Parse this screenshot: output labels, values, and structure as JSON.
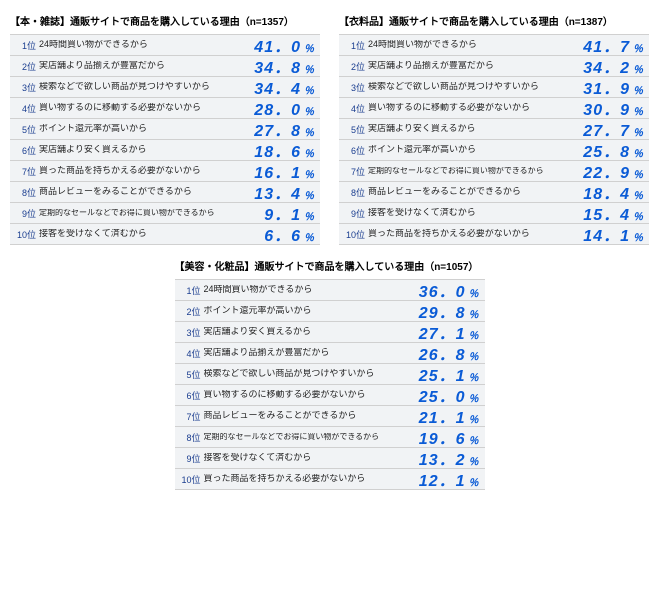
{
  "pct_label": "％",
  "rank_suffix": "位",
  "charts": [
    {
      "title": "【本・雑誌】通販サイトで商品を購入している理由（n=1357）",
      "rows": [
        {
          "rank": 1,
          "label": "24時間買い物ができるから",
          "value": "41．0"
        },
        {
          "rank": 2,
          "label": "実店舗より品揃えが豊富だから",
          "value": "34．8"
        },
        {
          "rank": 3,
          "label": "検索などで欲しい商品が見つけやすいから",
          "value": "34．4"
        },
        {
          "rank": 4,
          "label": "買い物するのに移動する必要がないから",
          "value": "28．0"
        },
        {
          "rank": 5,
          "label": "ポイント還元率が高いから",
          "value": "27．8"
        },
        {
          "rank": 6,
          "label": "実店舗より安く買えるから",
          "value": "18．6"
        },
        {
          "rank": 7,
          "label": "買った商品を持ちかえる必要がないから",
          "value": "16．1"
        },
        {
          "rank": 8,
          "label": "商品レビューをみることができるから",
          "value": "13．4"
        },
        {
          "rank": 9,
          "label": "定期的なセールなどでお得に買い物ができるから",
          "value": "9．1",
          "small": true
        },
        {
          "rank": 10,
          "label": "接客を受けなくて済むから",
          "value": "6．6"
        }
      ]
    },
    {
      "title": "【衣料品】通販サイトで商品を購入している理由（n=1387）",
      "rows": [
        {
          "rank": 1,
          "label": "24時間買い物ができるから",
          "value": "41．7"
        },
        {
          "rank": 2,
          "label": "実店舗より品揃えが豊富だから",
          "value": "34．2"
        },
        {
          "rank": 3,
          "label": "検索などで欲しい商品が見つけやすいから",
          "value": "31．9"
        },
        {
          "rank": 4,
          "label": "買い物するのに移動する必要がないから",
          "value": "30．9"
        },
        {
          "rank": 5,
          "label": "実店舗より安く買えるから",
          "value": "27．7"
        },
        {
          "rank": 6,
          "label": "ポイント還元率が高いから",
          "value": "25．8"
        },
        {
          "rank": 7,
          "label": "定期的なセールなどでお得に買い物ができるから",
          "value": "22．9",
          "small": true
        },
        {
          "rank": 8,
          "label": "商品レビューをみることができるから",
          "value": "18．4"
        },
        {
          "rank": 9,
          "label": "接客を受けなくて済むから",
          "value": "15．4"
        },
        {
          "rank": 10,
          "label": "買った商品を持ちかえる必要がないから",
          "value": "14．1"
        }
      ]
    },
    {
      "title": "【美容・化粧品】通販サイトで商品を購入している理由（n=1057）",
      "rows": [
        {
          "rank": 1,
          "label": "24時間買い物ができるから",
          "value": "36．0"
        },
        {
          "rank": 2,
          "label": "ポイント還元率が高いから",
          "value": "29．8"
        },
        {
          "rank": 3,
          "label": "実店舗より安く買えるから",
          "value": "27．1"
        },
        {
          "rank": 4,
          "label": "実店舗より品揃えが豊富だから",
          "value": "26．8"
        },
        {
          "rank": 5,
          "label": "検索などで欲しい商品が見つけやすいから",
          "value": "25．1"
        },
        {
          "rank": 6,
          "label": "買い物するのに移動する必要がないから",
          "value": "25．0"
        },
        {
          "rank": 7,
          "label": "商品レビューをみることができるから",
          "value": "21．1"
        },
        {
          "rank": 8,
          "label": "定期的なセールなどでお得に買い物ができるから",
          "value": "19．6",
          "small": true
        },
        {
          "rank": 9,
          "label": "接客を受けなくて済むから",
          "value": "13．2"
        },
        {
          "rank": 10,
          "label": "買った商品を持ちかえる必要がないから",
          "value": "12．1"
        }
      ]
    }
  ],
  "chart_data": [
    {
      "type": "table",
      "title": "【本・雑誌】通販サイトで商品を購入している理由",
      "n": 1357,
      "categories": [
        "24時間買い物ができるから",
        "実店舗より品揃えが豊富だから",
        "検索などで欲しい商品が見つけやすいから",
        "買い物するのに移動する必要がないから",
        "ポイント還元率が高いから",
        "実店舗より安く買えるから",
        "買った商品を持ちかえる必要がないから",
        "商品レビューをみることができるから",
        "定期的なセールなどでお得に買い物ができるから",
        "接客を受けなくて済むから"
      ],
      "values": [
        41.0,
        34.8,
        34.4,
        28.0,
        27.8,
        18.6,
        16.1,
        13.4,
        9.1,
        6.6
      ],
      "unit": "%"
    },
    {
      "type": "table",
      "title": "【衣料品】通販サイトで商品を購入している理由",
      "n": 1387,
      "categories": [
        "24時間買い物ができるから",
        "実店舗より品揃えが豊富だから",
        "検索などで欲しい商品が見つけやすいから",
        "買い物するのに移動する必要がないから",
        "実店舗より安く買えるから",
        "ポイント還元率が高いから",
        "定期的なセールなどでお得に買い物ができるから",
        "商品レビューをみることができるから",
        "接客を受けなくて済むから",
        "買った商品を持ちかえる必要がないから"
      ],
      "values": [
        41.7,
        34.2,
        31.9,
        30.9,
        27.7,
        25.8,
        22.9,
        18.4,
        15.4,
        14.1
      ],
      "unit": "%"
    },
    {
      "type": "table",
      "title": "【美容・化粧品】通販サイトで商品を購入している理由",
      "n": 1057,
      "categories": [
        "24時間買い物ができるから",
        "ポイント還元率が高いから",
        "実店舗より安く買えるから",
        "実店舗より品揃えが豊富だから",
        "検索などで欲しい商品が見つけやすいから",
        "買い物するのに移動する必要がないから",
        "商品レビューをみることができるから",
        "定期的なセールなどでお得に買い物ができるから",
        "接客を受けなくて済むから",
        "買った商品を持ちかえる必要がないから"
      ],
      "values": [
        36.0,
        29.8,
        27.1,
        26.8,
        25.1,
        25.0,
        21.1,
        19.6,
        13.2,
        12.1
      ],
      "unit": "%"
    }
  ]
}
